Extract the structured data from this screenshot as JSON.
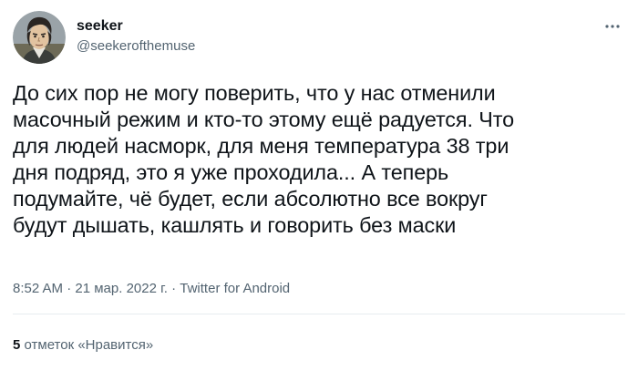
{
  "user": {
    "display_name": "seeker",
    "handle": "@seekerofthemuse"
  },
  "icons": {
    "avatar": "avatar-illustration",
    "more": "more-dots-icon"
  },
  "tweet": {
    "text": "До сих пор не могу поверить, что у нас отменили\nмасочный режим и кто-то этому ещё радуется. Что\nдля людей насморк, для меня температура 38 три\nдня подряд, это я уже проходила... А теперь\nподумайте, чё будет, если абсолютно все вокруг\nбудут дышать, кашлять и говорить без маски",
    "time": "8:52 AM",
    "separator": " · ",
    "date": "21 мар. 2022 г.",
    "source": "Twitter for Android"
  },
  "engagement": {
    "likes_count": "5",
    "likes_label": " отметок «Нравится»"
  },
  "colors": {
    "text_primary": "#0f1419",
    "text_secondary": "#536471",
    "divider": "#e6ecf0"
  }
}
